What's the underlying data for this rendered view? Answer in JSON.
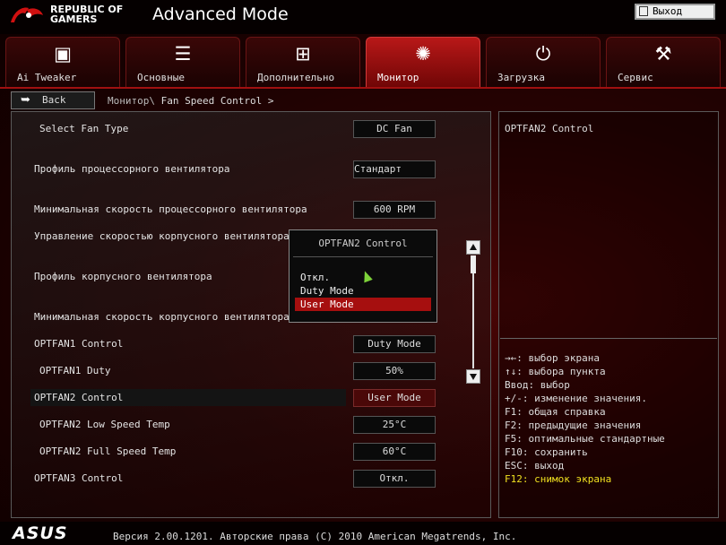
{
  "header": {
    "brand_line1": "REPUBLIC OF",
    "brand_line2": "GAMERS",
    "title": "Advanced Mode",
    "exit_label": "Выход"
  },
  "tabs": [
    {
      "label": "Ai Tweaker",
      "icon": "cooler-icon"
    },
    {
      "label": "Основные",
      "icon": "list-icon"
    },
    {
      "label": "Дополнительно",
      "icon": "board-icon"
    },
    {
      "label": "Монитор",
      "icon": "thermometer-icon",
      "active": true
    },
    {
      "label": "Загрузка",
      "icon": "power-icon"
    },
    {
      "label": "Сервис",
      "icon": "toolbox-icon"
    }
  ],
  "breadcrumb": {
    "back_label": "Back",
    "parent": "Монитор\\",
    "current": "Fan Speed Control >"
  },
  "settings": [
    {
      "label": "Select Fan Type",
      "value": "DC Fan",
      "indent": true
    },
    {
      "label": "Профиль процессорного вентилятора",
      "value": "Стандарт"
    },
    {
      "label": "Минимальная скорость процессорного вентилятора",
      "value": "600 RPM"
    },
    {
      "label": "Управление скоростью корпусного вентилятора",
      "value": ""
    },
    {
      "label": "Профиль корпусного вентилятора",
      "value": ""
    },
    {
      "label": "Минимальная скорость корпусного вентилятора",
      "value": ""
    },
    {
      "label": "OPTFAN1 Control",
      "value": "Duty Mode"
    },
    {
      "label": "OPTFAN1 Duty",
      "value": "50%",
      "indent": true
    },
    {
      "label": "OPTFAN2 Control",
      "value": "User Mode",
      "selected": true
    },
    {
      "label": "OPTFAN2 Low Speed Temp",
      "value": "25°C",
      "indent": true
    },
    {
      "label": "OPTFAN2 Full Speed Temp",
      "value": "60°C",
      "indent": true
    },
    {
      "label": "OPTFAN3 Control",
      "value": "Откл."
    }
  ],
  "popup": {
    "title": "OPTFAN2 Control",
    "options": [
      "Откл.",
      "Duty Mode",
      "User Mode"
    ],
    "selected_index": 2
  },
  "help": {
    "title": "OPTFAN2 Control",
    "lines": [
      "→←: выбор экрана",
      "↑↓: выбора пункта",
      "Ввод: выбор",
      "+/-: изменение значения.",
      "F1: общая справка",
      "F2: предыдущие значения",
      "F5: оптимальные стандартные",
      "F10: сохранить",
      "ESC: выход",
      "F12: снимок экрана"
    ],
    "accent_color": "#f0e020"
  },
  "footer": {
    "brand": "ASUS",
    "version": "Версия 2.00.1201. Авторские права (C) 2010 American Megatrends, Inc."
  }
}
